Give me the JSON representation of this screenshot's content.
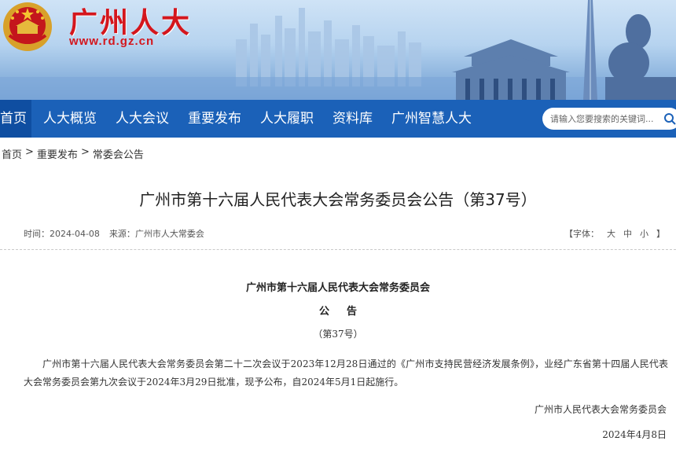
{
  "header": {
    "site_title": "广州人大",
    "site_url": "www.rd.gz.cn",
    "emblem_icon": "national-emblem-icon",
    "colors": {
      "brand_red": "#d4161d",
      "nav_blue": "#1b61b8",
      "nav_active": "#0f4ea1"
    }
  },
  "nav": {
    "items": [
      {
        "label": "首页"
      },
      {
        "label": "人大概览"
      },
      {
        "label": "人大会议"
      },
      {
        "label": "重要发布"
      },
      {
        "label": "人大履职"
      },
      {
        "label": "资料库"
      },
      {
        "label": "广州智慧人大"
      }
    ],
    "search_placeholder": "请输入您要搜索的关键词..."
  },
  "breadcrumb": {
    "items": [
      "首页",
      "重要发布",
      "常委会公告"
    ],
    "separator": ">"
  },
  "article": {
    "title": "广州市第十六届人民代表大会常务委员会公告（第37号）",
    "time_label": "时间：",
    "time_value": "2024-04-08",
    "source_label": "来源：",
    "source_value": "广州市人大常委会",
    "font_size_label_open": "【字体：",
    "font_size_options": [
      "大",
      "中",
      "小"
    ],
    "font_size_label_close": "】"
  },
  "document": {
    "org": "广州市第十六届人民代表大会常务委员会",
    "type": "公告",
    "number": "（第37号）",
    "body": "广州市第十六届人民代表大会常务委员会第二十二次会议于2023年12月28日通过的《广州市支持民营经济发展条例》，业经广东省第十四届人民代表大会常务委员会第九次会议于2024年3月29日批准，现予公布，自2024年5月1日起施行。",
    "signature": "广州市人民代表大会常务委员会",
    "date": "2024年4月8日"
  }
}
